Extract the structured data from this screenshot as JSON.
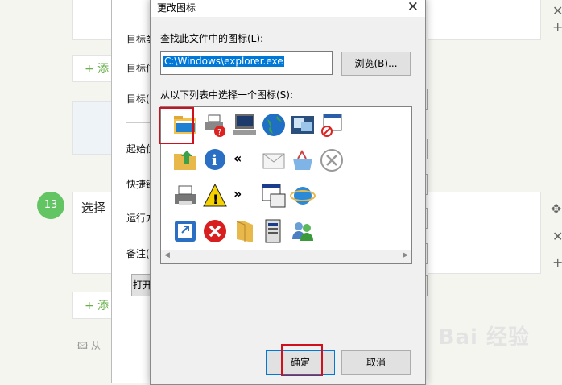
{
  "dialog": {
    "title": "更改图标",
    "search_label": "查找此文件中的图标(L):",
    "path_value": "C:\\Windows\\explorer.exe",
    "browse_label": "浏览(B)...",
    "list_label": "从以下列表中选择一个图标(S):",
    "ok_label": "确定",
    "cancel_label": "取消",
    "icons": [
      [
        "folder-icon",
        "printer-help-icon",
        "computer-icon",
        "globe-icon",
        "windows-icon",
        "no-entry-window-icon"
      ],
      [
        "folder-arrow-icon",
        "info-icon",
        "double-left-arrow-icon",
        "mail-icon",
        "shopping-basket-icon",
        "circle-x-icon"
      ],
      [
        "printer-icon",
        "warning-icon",
        "double-right-arrow-icon",
        "document-window-icon",
        "ie-globe-icon"
      ],
      [
        "arrow-window-icon",
        "error-icon",
        "folder-open-icon",
        "server-icon",
        "users-icon"
      ]
    ]
  },
  "background": {
    "step_number": "13",
    "step_text": "选择",
    "add_label": "+ 添",
    "from_label": "从",
    "prop_labels": [
      "目标类",
      "目标位",
      "目标(",
      "起始位",
      "快捷键",
      "运行方",
      "备注("
    ],
    "open_button": "打开"
  },
  "watermark": "Bai 经验"
}
